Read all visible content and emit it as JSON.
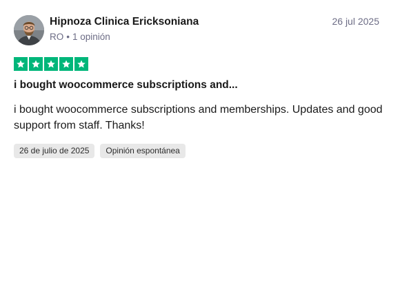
{
  "reviewer": {
    "name": "Hipnoza Clinica Ericksoniana",
    "country": "RO",
    "separator": "•",
    "review_count": "1 opinión",
    "avatar_icon": "user-photo-avatar"
  },
  "review": {
    "date_short": "26 jul 2025",
    "rating": 5,
    "rating_max": 5,
    "star_color": "#00b67a",
    "title": "i bought woocommerce subscriptions and...",
    "body": "i bought woocommerce subscriptions and memberships. Updates and good support from staff. Thanks!"
  },
  "tags": {
    "experience_date": "26 de julio de 2025",
    "review_type": "Opinión espontánea"
  }
}
